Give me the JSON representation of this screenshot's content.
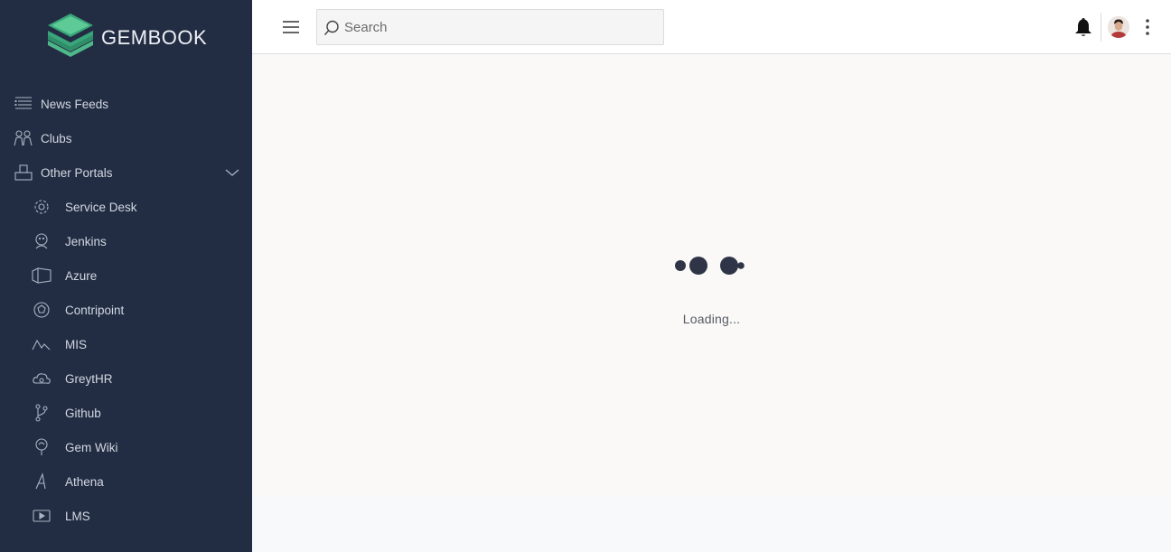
{
  "brand": {
    "name": "GEMBOOK"
  },
  "sidebar": {
    "items": [
      {
        "label": "News Feeds",
        "icon": "news-feed-icon"
      },
      {
        "label": "Clubs",
        "icon": "clubs-icon"
      },
      {
        "label": "Other Portals",
        "icon": "portals-icon",
        "expanded": true
      }
    ],
    "portals": [
      {
        "label": "Service Desk",
        "icon": "service-desk-icon"
      },
      {
        "label": "Jenkins",
        "icon": "jenkins-icon"
      },
      {
        "label": "Azure",
        "icon": "azure-icon"
      },
      {
        "label": "Contripoint",
        "icon": "contripoint-icon"
      },
      {
        "label": "MIS",
        "icon": "mis-icon"
      },
      {
        "label": "GreytHR",
        "icon": "greythr-icon"
      },
      {
        "label": "Github",
        "icon": "github-icon"
      },
      {
        "label": "Gem Wiki",
        "icon": "gem-wiki-icon"
      },
      {
        "label": "Athena",
        "icon": "athena-icon"
      },
      {
        "label": "LMS",
        "icon": "lms-icon"
      }
    ]
  },
  "header": {
    "search_placeholder": "Search"
  },
  "main": {
    "loading_text": "Loading..."
  },
  "colors": {
    "sidebar_bg": "#222d44",
    "logo_green": "#4fb88a",
    "loader_dots": "#2f3547"
  }
}
